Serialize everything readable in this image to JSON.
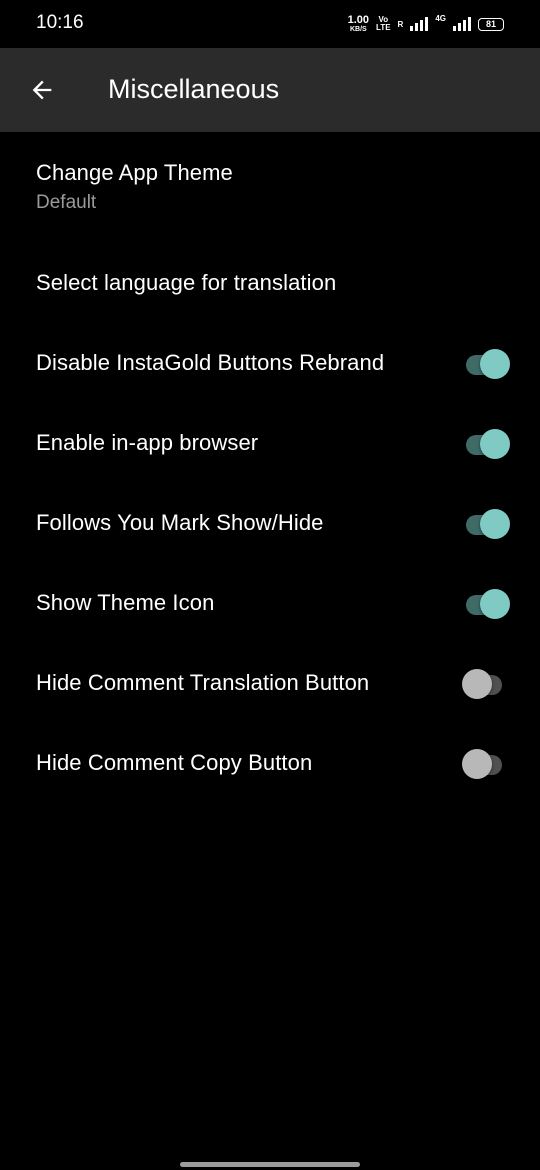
{
  "status_bar": {
    "time": "10:16",
    "net_speed_value": "1.00",
    "net_speed_unit": "KB/S",
    "volte_top": "Vo",
    "volte_bottom": "LTE",
    "roaming": "R",
    "network_type": "4G",
    "battery": "81"
  },
  "app_bar": {
    "back_icon": "arrow-left-icon",
    "title": "Miscellaneous"
  },
  "settings": {
    "items": [
      {
        "title": "Change App Theme",
        "summary": "Default"
      },
      {
        "title": "Select language for translation"
      },
      {
        "title": "Disable InstaGold Buttons Rebrand",
        "enabled": true
      },
      {
        "title": "Enable in-app browser",
        "enabled": true
      },
      {
        "title": "Follows You Mark Show/Hide",
        "enabled": true
      },
      {
        "title": "Show Theme Icon",
        "enabled": true
      },
      {
        "title": "Hide Comment Translation Button",
        "enabled": false
      },
      {
        "title": "Hide Comment Copy Button",
        "enabled": false
      }
    ]
  },
  "colors": {
    "background": "#000000",
    "app_bar": "#2b2b2b",
    "accent": "#7fcbc4",
    "accent_track": "#3f6b67",
    "summary_text": "#9a9a9a"
  }
}
